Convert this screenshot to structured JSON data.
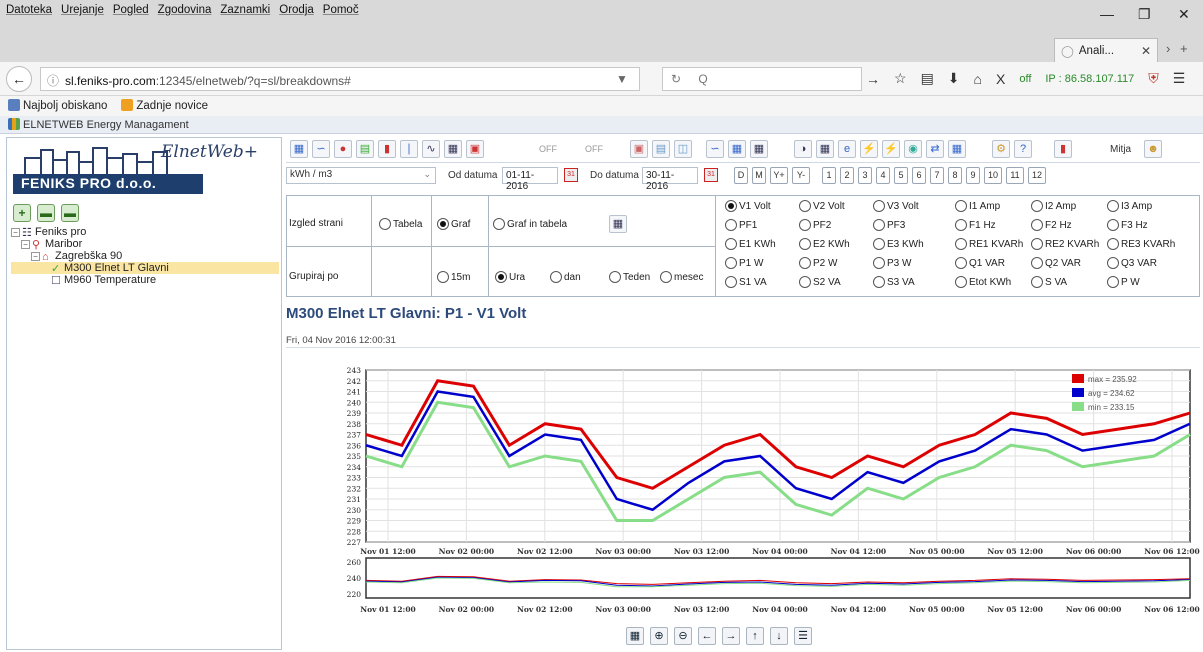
{
  "browser": {
    "menu": [
      "Datoteka",
      "Urejanje",
      "Pogled",
      "Zgodovina",
      "Zaznamki",
      "Orodja",
      "Pomoč"
    ],
    "tab_title": "Anali...",
    "url_host": "sl.feniks-pro.com",
    "url_rest": ":12345/elnetweb/?q=sl/breakdowns#",
    "search_placeholder": "Q",
    "off_label": "off",
    "ip": "IP : 86.58.107.117",
    "bookmarks": [
      "Najbolj obiskano",
      "Zadnje novice"
    ],
    "app_title": "ELNETWEB Energy Managament"
  },
  "logo": {
    "script": "ElnetWeb+",
    "banner": "FENIKS PRO d.o.o."
  },
  "tree": [
    {
      "label": "Feniks pro",
      "level": 0
    },
    {
      "label": "Maribor",
      "level": 1
    },
    {
      "label": "Zagrebška 90",
      "level": 2
    },
    {
      "label": "M300 Elnet LT Glavni",
      "level": 3,
      "selected": true
    },
    {
      "label": "M960 Temperature",
      "level": 3
    }
  ],
  "toolbar": {
    "off1": "OFF",
    "off2": "OFF",
    "user": "Mitja",
    "unit": "kWh / m3",
    "from_label": "Od datuma",
    "from_value": "01-11-2016",
    "to_label": "Do datuma",
    "to_value": "30-11-2016",
    "period_buttons": [
      "D",
      "M",
      "Y+",
      "Y-"
    ],
    "months": [
      "1",
      "2",
      "3",
      "4",
      "5",
      "6",
      "7",
      "8",
      "9",
      "10",
      "11",
      "12"
    ]
  },
  "options": {
    "view_label": "Izgled strani",
    "view": [
      "Tabela",
      "Graf",
      "Graf in tabela"
    ],
    "group_label": "Grupiraj po",
    "group": [
      "15m",
      "Ura",
      "dan",
      "Teden",
      "mesec"
    ],
    "params": [
      [
        "V1 Volt",
        "V2 Volt",
        "V3 Volt",
        "I1 Amp",
        "I2 Amp",
        "I3 Amp"
      ],
      [
        "PF1",
        "PF2",
        "PF3",
        "F1 Hz",
        "F2 Hz",
        "F3 Hz"
      ],
      [
        "E1 KWh",
        "E2 KWh",
        "E3 KWh",
        "RE1 KVARh",
        "RE2 KVARh",
        "RE3 KVARh"
      ],
      [
        "P1 W",
        "P2 W",
        "P3 W",
        "Q1 VAR",
        "Q2 VAR",
        "Q3 VAR"
      ],
      [
        "S1 VA",
        "S2 VA",
        "S3 VA",
        "Etot KWh",
        "S VA",
        "P W"
      ]
    ]
  },
  "chart_title": "M300 Elnet LT Glavni: P1 - V1 Volt",
  "chart_date": "Fri, 04 Nov 2016 12:00:31",
  "chart_data": {
    "type": "line",
    "x": [
      "Nov 01 00:00",
      "Nov 01 06:00",
      "Nov 01 12:00",
      "Nov 01 18:00",
      "Nov 02 00:00",
      "Nov 02 06:00",
      "Nov 02 12:00",
      "Nov 02 18:00",
      "Nov 03 00:00",
      "Nov 03 06:00",
      "Nov 03 12:00",
      "Nov 03 18:00",
      "Nov 04 00:00",
      "Nov 04 06:00",
      "Nov 04 12:00",
      "Nov 04 18:00",
      "Nov 05 00:00",
      "Nov 05 06:00",
      "Nov 05 12:00",
      "Nov 05 18:00",
      "Nov 06 00:00",
      "Nov 06 06:00",
      "Nov 06 12:00",
      "Nov 06 18:00"
    ],
    "x_ticks": [
      "Nov 01 12:00",
      "Nov 02 00:00",
      "Nov 02 12:00",
      "Nov 03 00:00",
      "Nov 03 12:00",
      "Nov 04 00:00",
      "Nov 04 12:00",
      "Nov 05 00:00",
      "Nov 05 12:00",
      "Nov 06 00:00",
      "Nov 06 12:00"
    ],
    "y_ticks": [
      243,
      242,
      241,
      240,
      239,
      238,
      237,
      236,
      235,
      234,
      233,
      232,
      231,
      230,
      229,
      228,
      227
    ],
    "ylim": [
      227,
      243
    ],
    "series": [
      {
        "name": "max = 235.92",
        "color": "#dd0000",
        "values": [
          237,
          236,
          242,
          241.5,
          236,
          238,
          237.5,
          233,
          232,
          234,
          236,
          237,
          234,
          233,
          235,
          234,
          236,
          237,
          239,
          238.5,
          237,
          237.5,
          238,
          239
        ]
      },
      {
        "name": "avg = 234.62",
        "color": "#0000cc",
        "values": [
          236,
          235,
          241,
          240.5,
          235,
          237,
          236.5,
          231,
          230,
          232.5,
          234.5,
          235,
          232,
          231,
          233.5,
          232.5,
          234.5,
          235.5,
          237.5,
          237,
          235.5,
          236,
          236.5,
          238
        ]
      },
      {
        "name": "min = 233.15",
        "color": "#88dd88",
        "values": [
          235,
          234,
          240,
          239.5,
          234,
          235,
          234.5,
          229,
          229,
          231,
          233,
          233.5,
          230.5,
          229.5,
          232,
          231,
          233,
          234,
          236,
          235.5,
          234,
          234.5,
          235,
          237
        ]
      }
    ],
    "nav_y_ticks": [
      260,
      240,
      220
    ],
    "legend_position": "top-right",
    "grid": true
  }
}
